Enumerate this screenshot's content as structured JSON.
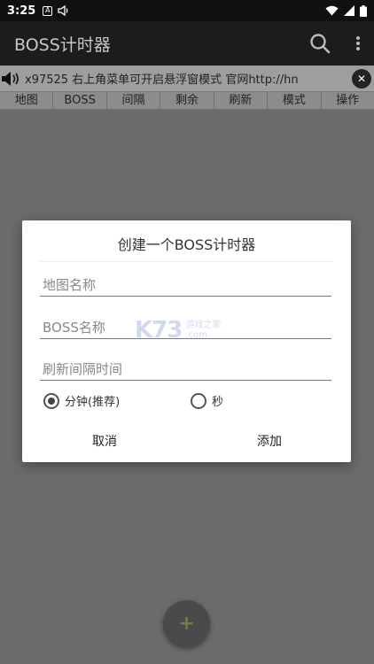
{
  "status_bar": {
    "time": "3:25",
    "icon_a_label": "A"
  },
  "app_bar": {
    "title": "BOSS计时器"
  },
  "marquee": {
    "text": "x97525 右上角菜单可开启悬浮窗模式 官网http://hn",
    "close_label": "✕"
  },
  "columns": [
    "地图",
    "BOSS",
    "间隔",
    "剩余",
    "刷新",
    "模式",
    "操作"
  ],
  "dialog": {
    "title": "创建一个BOSS计时器",
    "map_placeholder": "地图名称",
    "boss_placeholder": "BOSS名称",
    "interval_placeholder": "刷新间隔时间",
    "radio_minutes": "分钟(推荐)",
    "radio_seconds": "秒",
    "cancel_label": "取消",
    "add_label": "添加"
  },
  "watermark": {
    "logo": "K73",
    "sub1": "游戏之家",
    "sub2": ".com"
  },
  "fab": {
    "label": "+"
  }
}
